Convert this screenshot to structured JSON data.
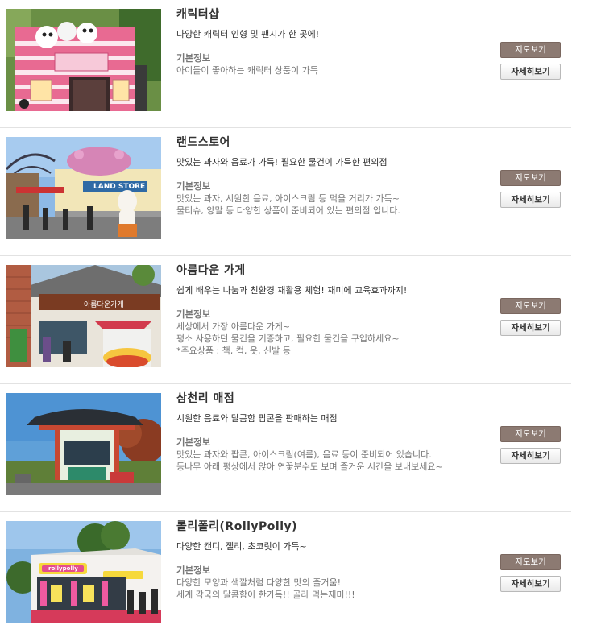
{
  "shops": [
    {
      "title": "캐릭터샵",
      "desc": "다양한 캐릭터 인형 및 팬시가 한 곳에!",
      "info_label": "기본정보",
      "detail_lines": [
        "아이들이 좋아하는 캐릭터 상품이 가득"
      ],
      "map_label": "지도보기",
      "detail_button_label": "자세히보기"
    },
    {
      "title": "랜드스토어",
      "desc": "맛있는 과자와 음료가 가득! 필요한 물건이 가득한 편의점",
      "info_label": "기본정보",
      "detail_lines": [
        "맛있는 과자, 시원한 음료, 아이스크림 등 먹을 거리가 가득~",
        "물티슈, 양말 등 다양한 상품이 준비되어 있는 편의점 입니다."
      ],
      "map_label": "지도보기",
      "detail_button_label": "자세히보기",
      "image_sign": "LAND STORE"
    },
    {
      "title": "아름다운 가게",
      "desc": "쉽게 배우는 나눔과 친환경 재활용 체험! 재미에 교육효과까지!",
      "info_label": "기본정보",
      "detail_lines": [
        "세상에서 가장 아름다운 가게~",
        "평소 사용하던 물건을 기증하고, 필요한 물건을 구입하세요~",
        "*주요상품 : 책, 컵, 옷, 신발 등"
      ],
      "map_label": "지도보기",
      "detail_button_label": "자세히보기",
      "image_sign": "아름다운가게"
    },
    {
      "title": "삼천리 매점",
      "desc": "시원한 음료와 달콤함 팝콘을 판매하는 매점",
      "info_label": "기본정보",
      "detail_lines": [
        "맛있는 과자와 팝콘, 아이스크림(여름), 음료 등이 준비되어 있습니다.",
        "등나무 아래 평상에서 앉아 연꽃분수도 보며 즐거운 시간을 보내보세요~"
      ],
      "map_label": "지도보기",
      "detail_button_label": "자세히보기"
    },
    {
      "title": "롤리폴리(RollyPolly)",
      "desc": "다양한 캔디, 젤리, 초코릿이 가득~",
      "info_label": "기본정보",
      "detail_lines": [
        "다양한 모양과 색깔처럼 다양한 맛의 즐거움!",
        "세계 각국의 달콤함이 한가득!! 골라 먹는재미!!!"
      ],
      "map_label": "지도보기",
      "detail_button_label": "자세히보기",
      "image_sign": "rollypolly"
    }
  ]
}
